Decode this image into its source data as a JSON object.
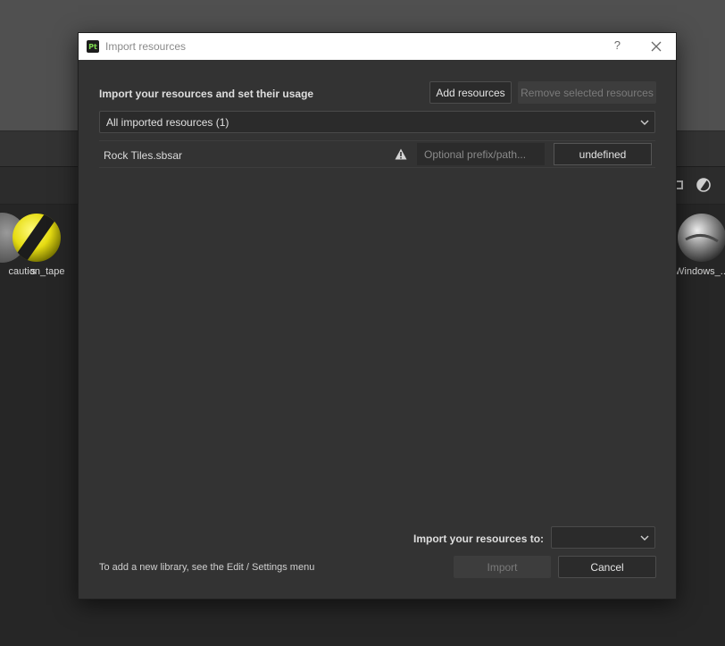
{
  "background": {
    "materials": [
      {
        "label": "caution_tape",
        "icon": "caution-tape-sphere"
      },
      {
        "label": "Windows_...",
        "icon": "metal-sphere"
      }
    ],
    "partial_label": "s"
  },
  "dialog": {
    "app_icon_text": "Pt",
    "title": "Import resources",
    "help_glyph": "?",
    "heading": "Import your resources and set their usage",
    "add_button": "Add resources",
    "remove_button": "Remove selected resources",
    "filter_value": "All imported resources (1)",
    "resources": [
      {
        "name": "Rock Tiles.sbsar",
        "status_icon": "warning-icon",
        "prefix_placeholder": "Optional prefix/path...",
        "prefix_value": "",
        "usage": "undefined"
      }
    ],
    "import_to_label": "Import your resources to:",
    "import_to_value": "",
    "hint": "To add a new library, see the Edit / Settings menu",
    "import_button": "Import",
    "cancel_button": "Cancel"
  },
  "colors": {
    "dialog_bg": "#333333",
    "titlebar_bg": "#ffffff",
    "field_bg": "#2b2b2b",
    "app_icon_green": "#7fdc4f",
    "disabled_text": "#7a7a7a"
  }
}
